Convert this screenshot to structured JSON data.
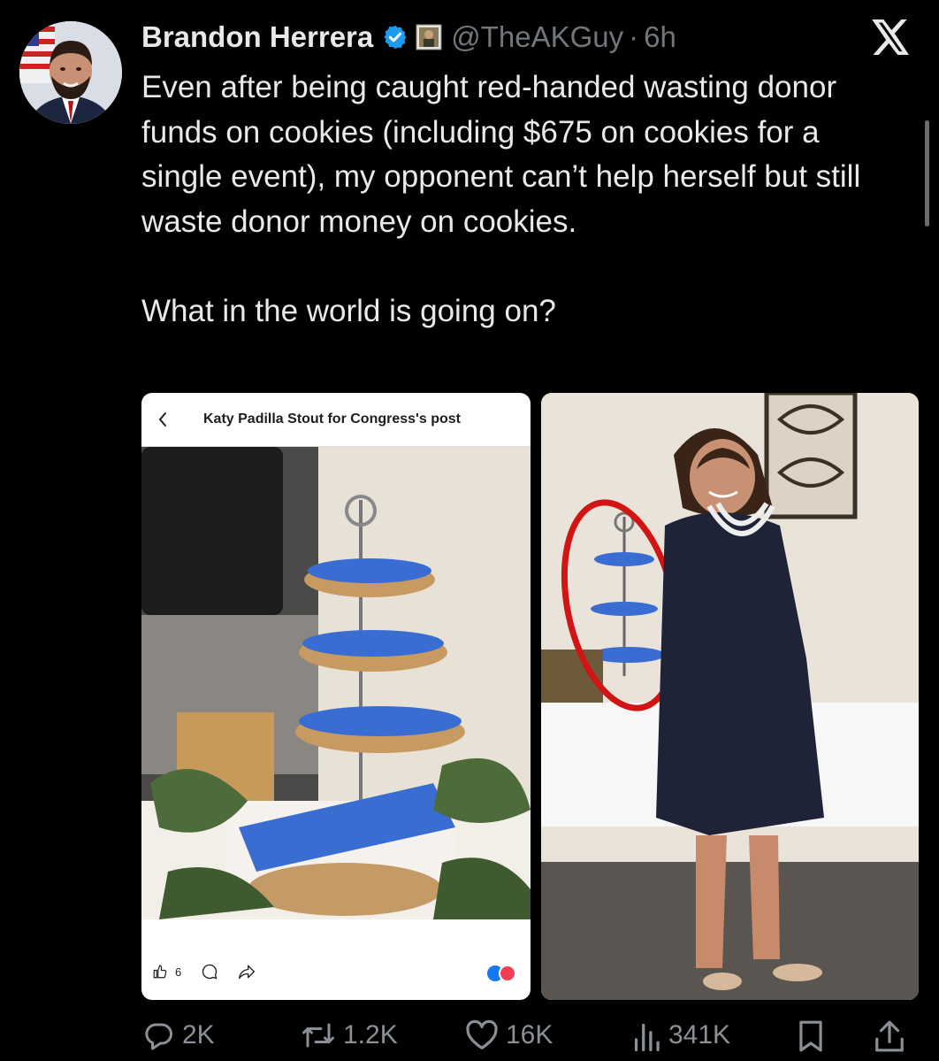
{
  "tweet": {
    "author_name": "Brandon Herrera",
    "handle": "@TheAKGuy",
    "separator": "·",
    "time": "6h",
    "text": "Even after being caught red-handed wasting donor funds on cookies (including $675 on cookies for a single event), my opponent can’t help herself but still waste donor money on cookies.\n\nWhat in the world is going on?",
    "verified_icon": "verified-badge-icon",
    "brand_icon": "x-logo-icon"
  },
  "embedded_post": {
    "title": "Katy Padilla Stout for Congress's post",
    "like_count": "6",
    "back_icon": "chevron-left-icon",
    "reactions_icon": "reactions-icon"
  },
  "actions": {
    "replies": "2K",
    "reposts": "1.2K",
    "likes": "16K",
    "views": "341K"
  },
  "colors": {
    "background": "#000000",
    "text": "#e7e9ea",
    "muted": "#71767b",
    "verified": "#1d9bf0",
    "annotation_circle": "#d11414"
  }
}
